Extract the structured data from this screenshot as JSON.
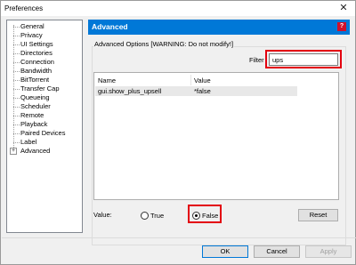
{
  "window": {
    "title": "Preferences",
    "close_glyph": "✕"
  },
  "tree": {
    "items": [
      {
        "label": "General"
      },
      {
        "label": "Privacy"
      },
      {
        "label": "UI Settings"
      },
      {
        "label": "Directories"
      },
      {
        "label": "Connection"
      },
      {
        "label": "Bandwidth"
      },
      {
        "label": "BitTorrent"
      },
      {
        "label": "Transfer Cap"
      },
      {
        "label": "Queueing"
      },
      {
        "label": "Scheduler"
      },
      {
        "label": "Remote"
      },
      {
        "label": "Playback"
      },
      {
        "label": "Paired Devices"
      },
      {
        "label": "Label"
      },
      {
        "label": "Advanced",
        "expander": "+"
      }
    ]
  },
  "panel": {
    "title": "Advanced",
    "help_glyph": "?",
    "group_label": "Advanced Options [WARNING: Do not modify!]",
    "filter_label": "Filter",
    "filter_value": "ups",
    "table": {
      "columns": [
        "Name",
        "Value"
      ],
      "rows": [
        {
          "name": "gui.show_plus_upsell",
          "value": "*false"
        }
      ]
    },
    "value_label": "Value:",
    "radio_true": "True",
    "radio_false": "False",
    "selected_value": "False",
    "reset_label": "Reset"
  },
  "buttons": {
    "ok": "OK",
    "cancel": "Cancel",
    "apply": "Apply"
  },
  "colors": {
    "accent": "#0078d7",
    "highlight": "#e3000f",
    "help_icon": "#d0102a"
  }
}
